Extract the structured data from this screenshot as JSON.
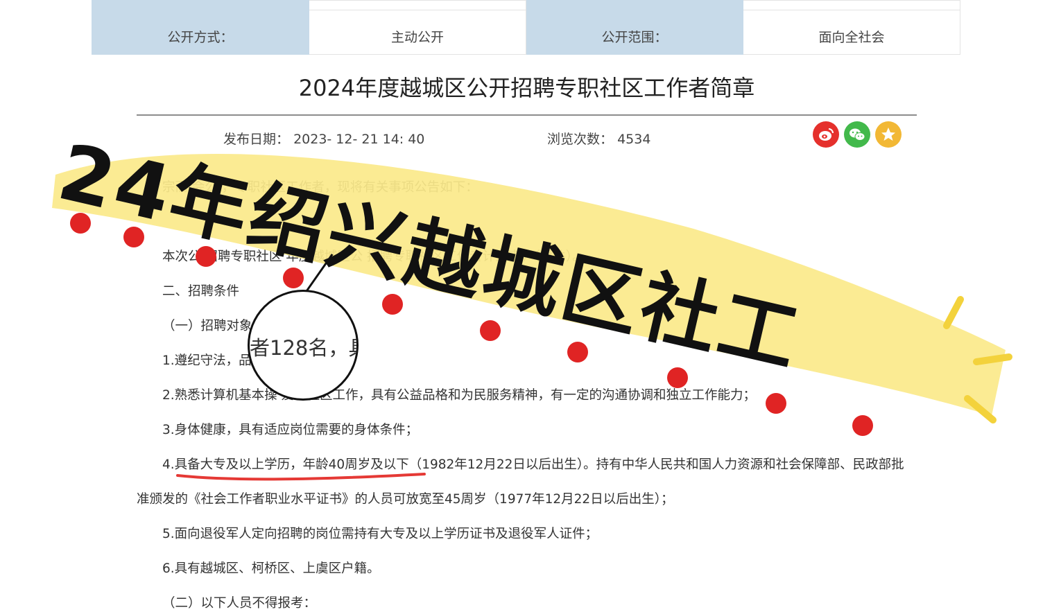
{
  "meta": {
    "method_label": "公开方式：",
    "method_value": "主动公开",
    "scope_label": "公开范围：",
    "scope_value": "面向全社会"
  },
  "article": {
    "title": "2024年度越城区公开招聘专职社区工作者简章",
    "pubdate_label": "发布日期：",
    "pubdate_value": "2023- 12- 21 14: 40",
    "views_label": "浏览次数：",
    "views_value": "4534",
    "lines": [
      "    宗而    会公  ，专职社区工作者，现将有关事项公告如下：",
      "本次公  招聘专职社区                    年度越城区公  招聘专职社区工作者计划表》（附件）。",
      "二、招聘条件",
      "（一）招聘对象",
      "1.遵纪守法，品                 ；",
      "2.熟悉计算机基本操     爱心社区工作，具有公益品格和为民服务精神，有一定的沟通协调和独立工作能力；",
      "3.身体健康，具有适应岗位需要的身体条件；",
      "4.具备大专及以上学历，年龄40周岁及以下（1982年12月22日以后出生）。持有中华人民共和国人力资源和社会保障部、民政部批",
      "准颁发的《社会工作者职业水平证书》的人员可放宽至45周岁（1977年12月22日以后出生）；",
      "5.面向退役军人定向招聘的岗位需持有大专及以上学历证书及退役军人证件；",
      "6.具有越城区、柯桥区、上虞区户籍。",
      "（二）以下人员不得报考："
    ],
    "magnified_text": "者128名，具备"
  },
  "overlay": {
    "headline": "24年绍兴越城区社工",
    "highlight_color": "#fbe98a",
    "dot_color": "#e02424"
  },
  "icons": [
    "weibo-icon",
    "wechat-icon",
    "favorite-star-icon"
  ]
}
